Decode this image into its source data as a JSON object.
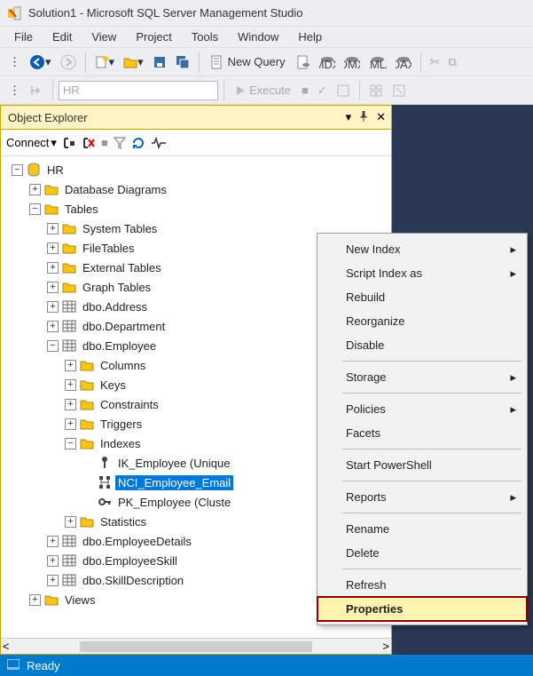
{
  "title": "Solution1 - Microsoft SQL Server Management Studio",
  "menu": [
    "File",
    "Edit",
    "View",
    "Project",
    "Tools",
    "Window",
    "Help"
  ],
  "toolbar1": {
    "new_query": "New Query",
    "quick_launch_placeholder": "HR"
  },
  "toolbar2": {
    "db_dropdown": "HR",
    "execute": "Execute"
  },
  "object_explorer": {
    "title": "Object Explorer",
    "connect_label": "Connect",
    "tree": {
      "db": "HR",
      "nodes": {
        "db_diagrams": "Database Diagrams",
        "tables": "Tables",
        "system_tables": "System Tables",
        "file_tables": "FileTables",
        "external_tables": "External Tables",
        "graph_tables": "Graph Tables",
        "tbl_address": "dbo.Address",
        "tbl_department": "dbo.Department",
        "tbl_employee": "dbo.Employee",
        "columns": "Columns",
        "keys": "Keys",
        "constraints": "Constraints",
        "triggers": "Triggers",
        "indexes": "Indexes",
        "idx_ik": "IK_Employee (Unique",
        "idx_nci": "NCI_Employee_Email",
        "idx_pk": "PK_Employee (Cluste",
        "statistics": "Statistics",
        "tbl_emp_details": "dbo.EmployeeDetails",
        "tbl_emp_skill": "dbo.EmployeeSkill",
        "tbl_skill_desc": "dbo.SkillDescription",
        "views": "Views"
      }
    }
  },
  "context_menu": {
    "new_index": "New Index",
    "script_index": "Script Index as",
    "rebuild": "Rebuild",
    "reorganize": "Reorganize",
    "disable": "Disable",
    "storage": "Storage",
    "policies": "Policies",
    "facets": "Facets",
    "start_ps": "Start PowerShell",
    "reports": "Reports",
    "rename": "Rename",
    "delete": "Delete",
    "refresh": "Refresh",
    "properties": "Properties"
  },
  "status": "Ready"
}
